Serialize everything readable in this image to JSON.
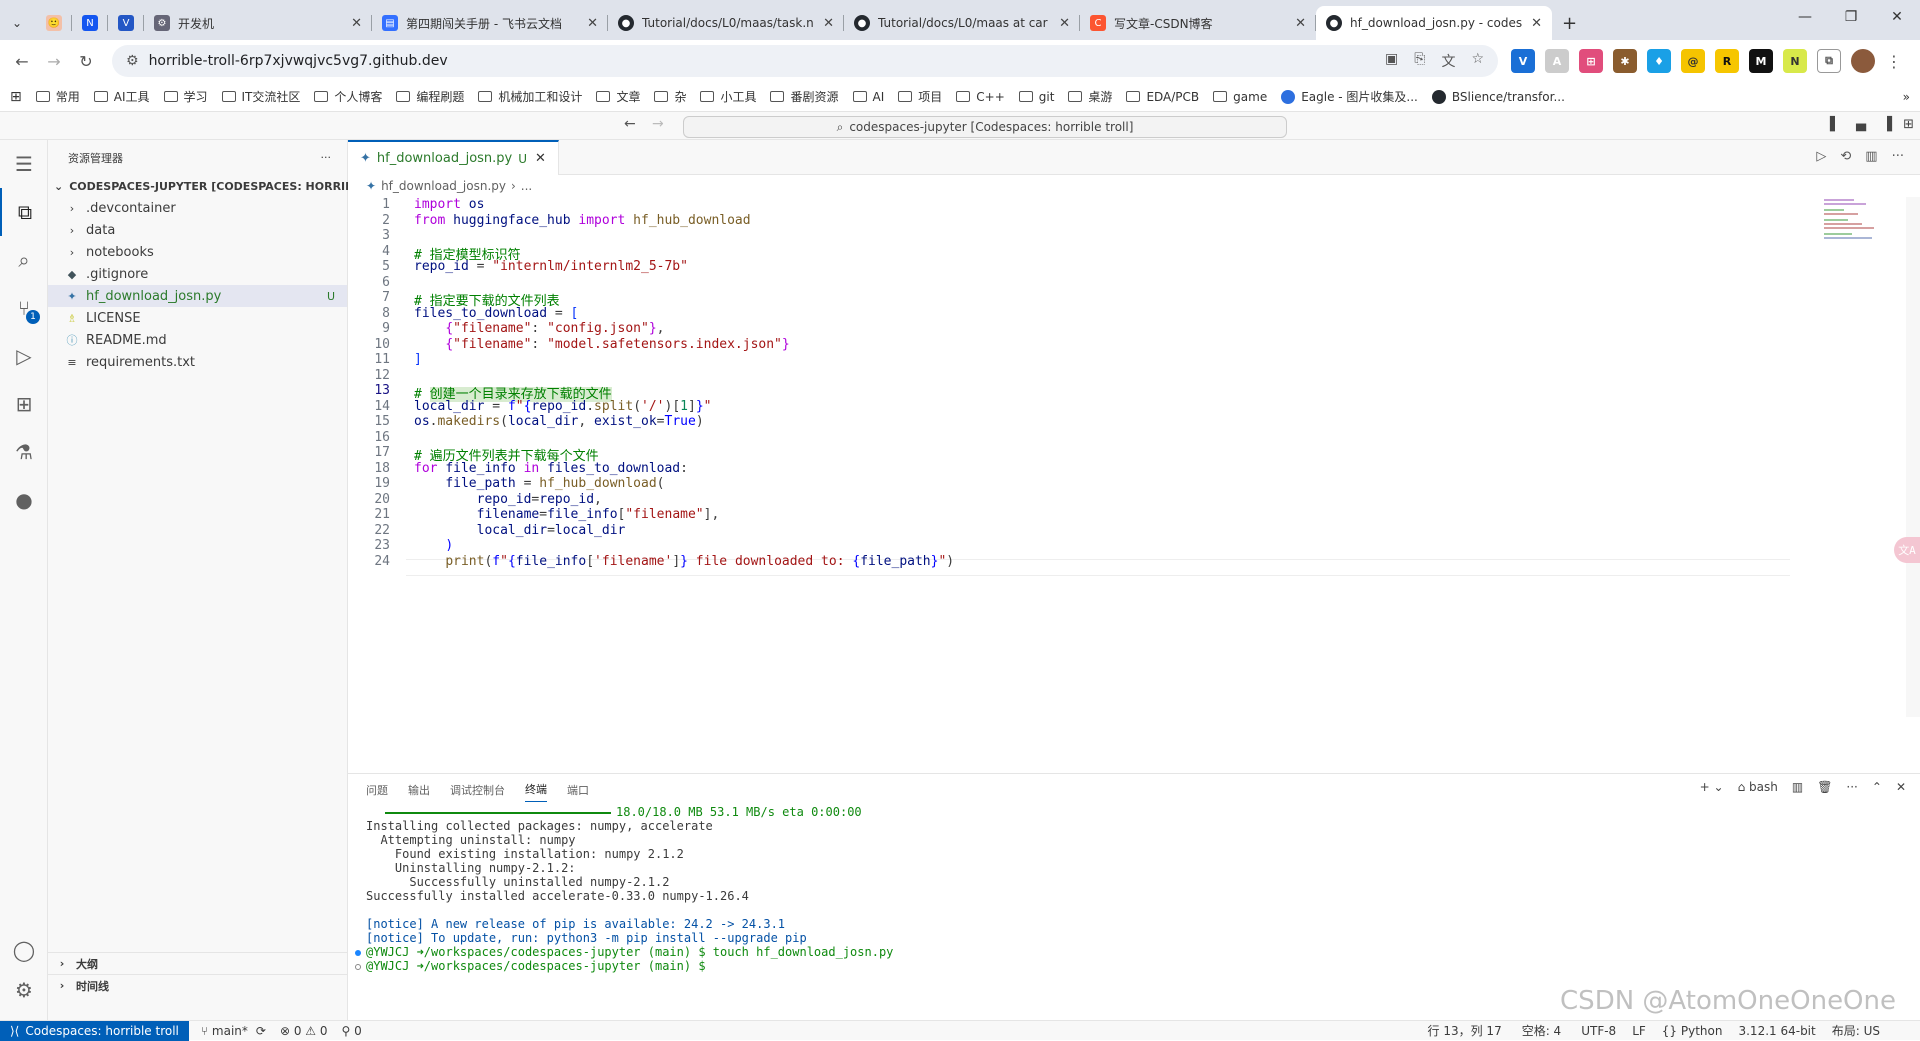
{
  "browser": {
    "tabs": [
      {
        "label": "",
        "icon": "tab-list-icon"
      },
      {
        "label": "",
        "icon": "app-icon"
      },
      {
        "label": "",
        "icon": "app-icon"
      },
      {
        "label": "",
        "icon": "app-icon"
      },
      {
        "label": "开发机"
      },
      {
        "label": "第四期闯关手册 - 飞书云文档"
      },
      {
        "label": "Tutorial/docs/L0/maas/task.n"
      },
      {
        "label": "Tutorial/docs/L0/maas at car"
      },
      {
        "label": "写文章-CSDN博客"
      },
      {
        "label": "hf_download_josn.py - codes"
      }
    ],
    "url": "horrible-troll-6rp7xjvwqjvc5vg7.github.dev",
    "bookmarks": [
      "常用",
      "AI工具",
      "学习",
      "IT交流社区",
      "个人博客",
      "编程刷题",
      "机械加工和设计",
      "文章",
      "杂",
      "小工具",
      "番剧资源",
      "AI",
      "项目",
      "C++",
      "git",
      "桌游",
      "EDA/PCB",
      "game",
      "Eagle - 图片收集及...",
      "BSlience/transfor..."
    ]
  },
  "vscode": {
    "command_center": "codespaces-jupyter [Codespaces: horrible troll]",
    "explorer": {
      "title": "资源管理器",
      "root": "CODESPACES-JUPYTER [CODESPACES: HORRIBLE TR...",
      "items": [
        {
          "label": ".devcontainer",
          "kind": "folder"
        },
        {
          "label": "data",
          "kind": "folder"
        },
        {
          "label": "notebooks",
          "kind": "folder"
        },
        {
          "label": ".gitignore",
          "kind": "file"
        },
        {
          "label": "hf_download_josn.py",
          "kind": "file",
          "badge": "U"
        },
        {
          "label": "LICENSE",
          "kind": "file"
        },
        {
          "label": "README.md",
          "kind": "file"
        },
        {
          "label": "requirements.txt",
          "kind": "file"
        }
      ],
      "outline": "大纲",
      "timeline": "时间线"
    },
    "editor": {
      "tab": "hf_download_josn.py",
      "tab_badge": "U",
      "breadcrumb": "hf_download_josn.py",
      "breadcrumb_more": "...",
      "line_numbers": [
        "1",
        "2",
        "3",
        "4",
        "5",
        "6",
        "7",
        "8",
        "9",
        "10",
        "11",
        "12",
        "13",
        "14",
        "15",
        "16",
        "17",
        "18",
        "19",
        "20",
        "21",
        "22",
        "23",
        "24"
      ]
    },
    "panel": {
      "tabs": [
        "问题",
        "输出",
        "调试控制台",
        "终端",
        "端口"
      ],
      "shell": "bash",
      "lines": {
        "l1": "18.0/18.0 MB 53.1 MB/s eta 0:00:00",
        "l2": "Installing collected packages: numpy, accelerate",
        "l3": "  Attempting uninstall: numpy",
        "l4": "    Found existing installation: numpy 2.1.2",
        "l5": "    Uninstalling numpy-2.1.2:",
        "l6": "      Successfully uninstalled numpy-2.1.2",
        "l7": "Successfully installed accelerate-0.33.0 numpy-1.26.4",
        "l8": "[notice] A new release of pip is available: 24.2 -> 24.3.1",
        "l9": "[notice] To update, run: python3 -m pip install --upgrade pip",
        "l10": "@YWJCJ ➜/workspaces/codespaces-jupyter (main) $ touch hf_download_josn.py",
        "l11": "@YWJCJ ➜/workspaces/codespaces-jupyter (main) $ "
      }
    },
    "status": {
      "remote": "Codespaces: horrible troll",
      "branch": "main*",
      "problems": "0",
      "warnings": "0",
      "ports": "0",
      "position": "行 13，列 17",
      "spaces": "空格: 4",
      "encoding": "UTF-8",
      "eol": "LF",
      "language": "Python",
      "interpreter": "3.12.1 64-bit",
      "layout": "布局: US"
    },
    "watermark": "CSDN @AtomOneOneOne"
  }
}
